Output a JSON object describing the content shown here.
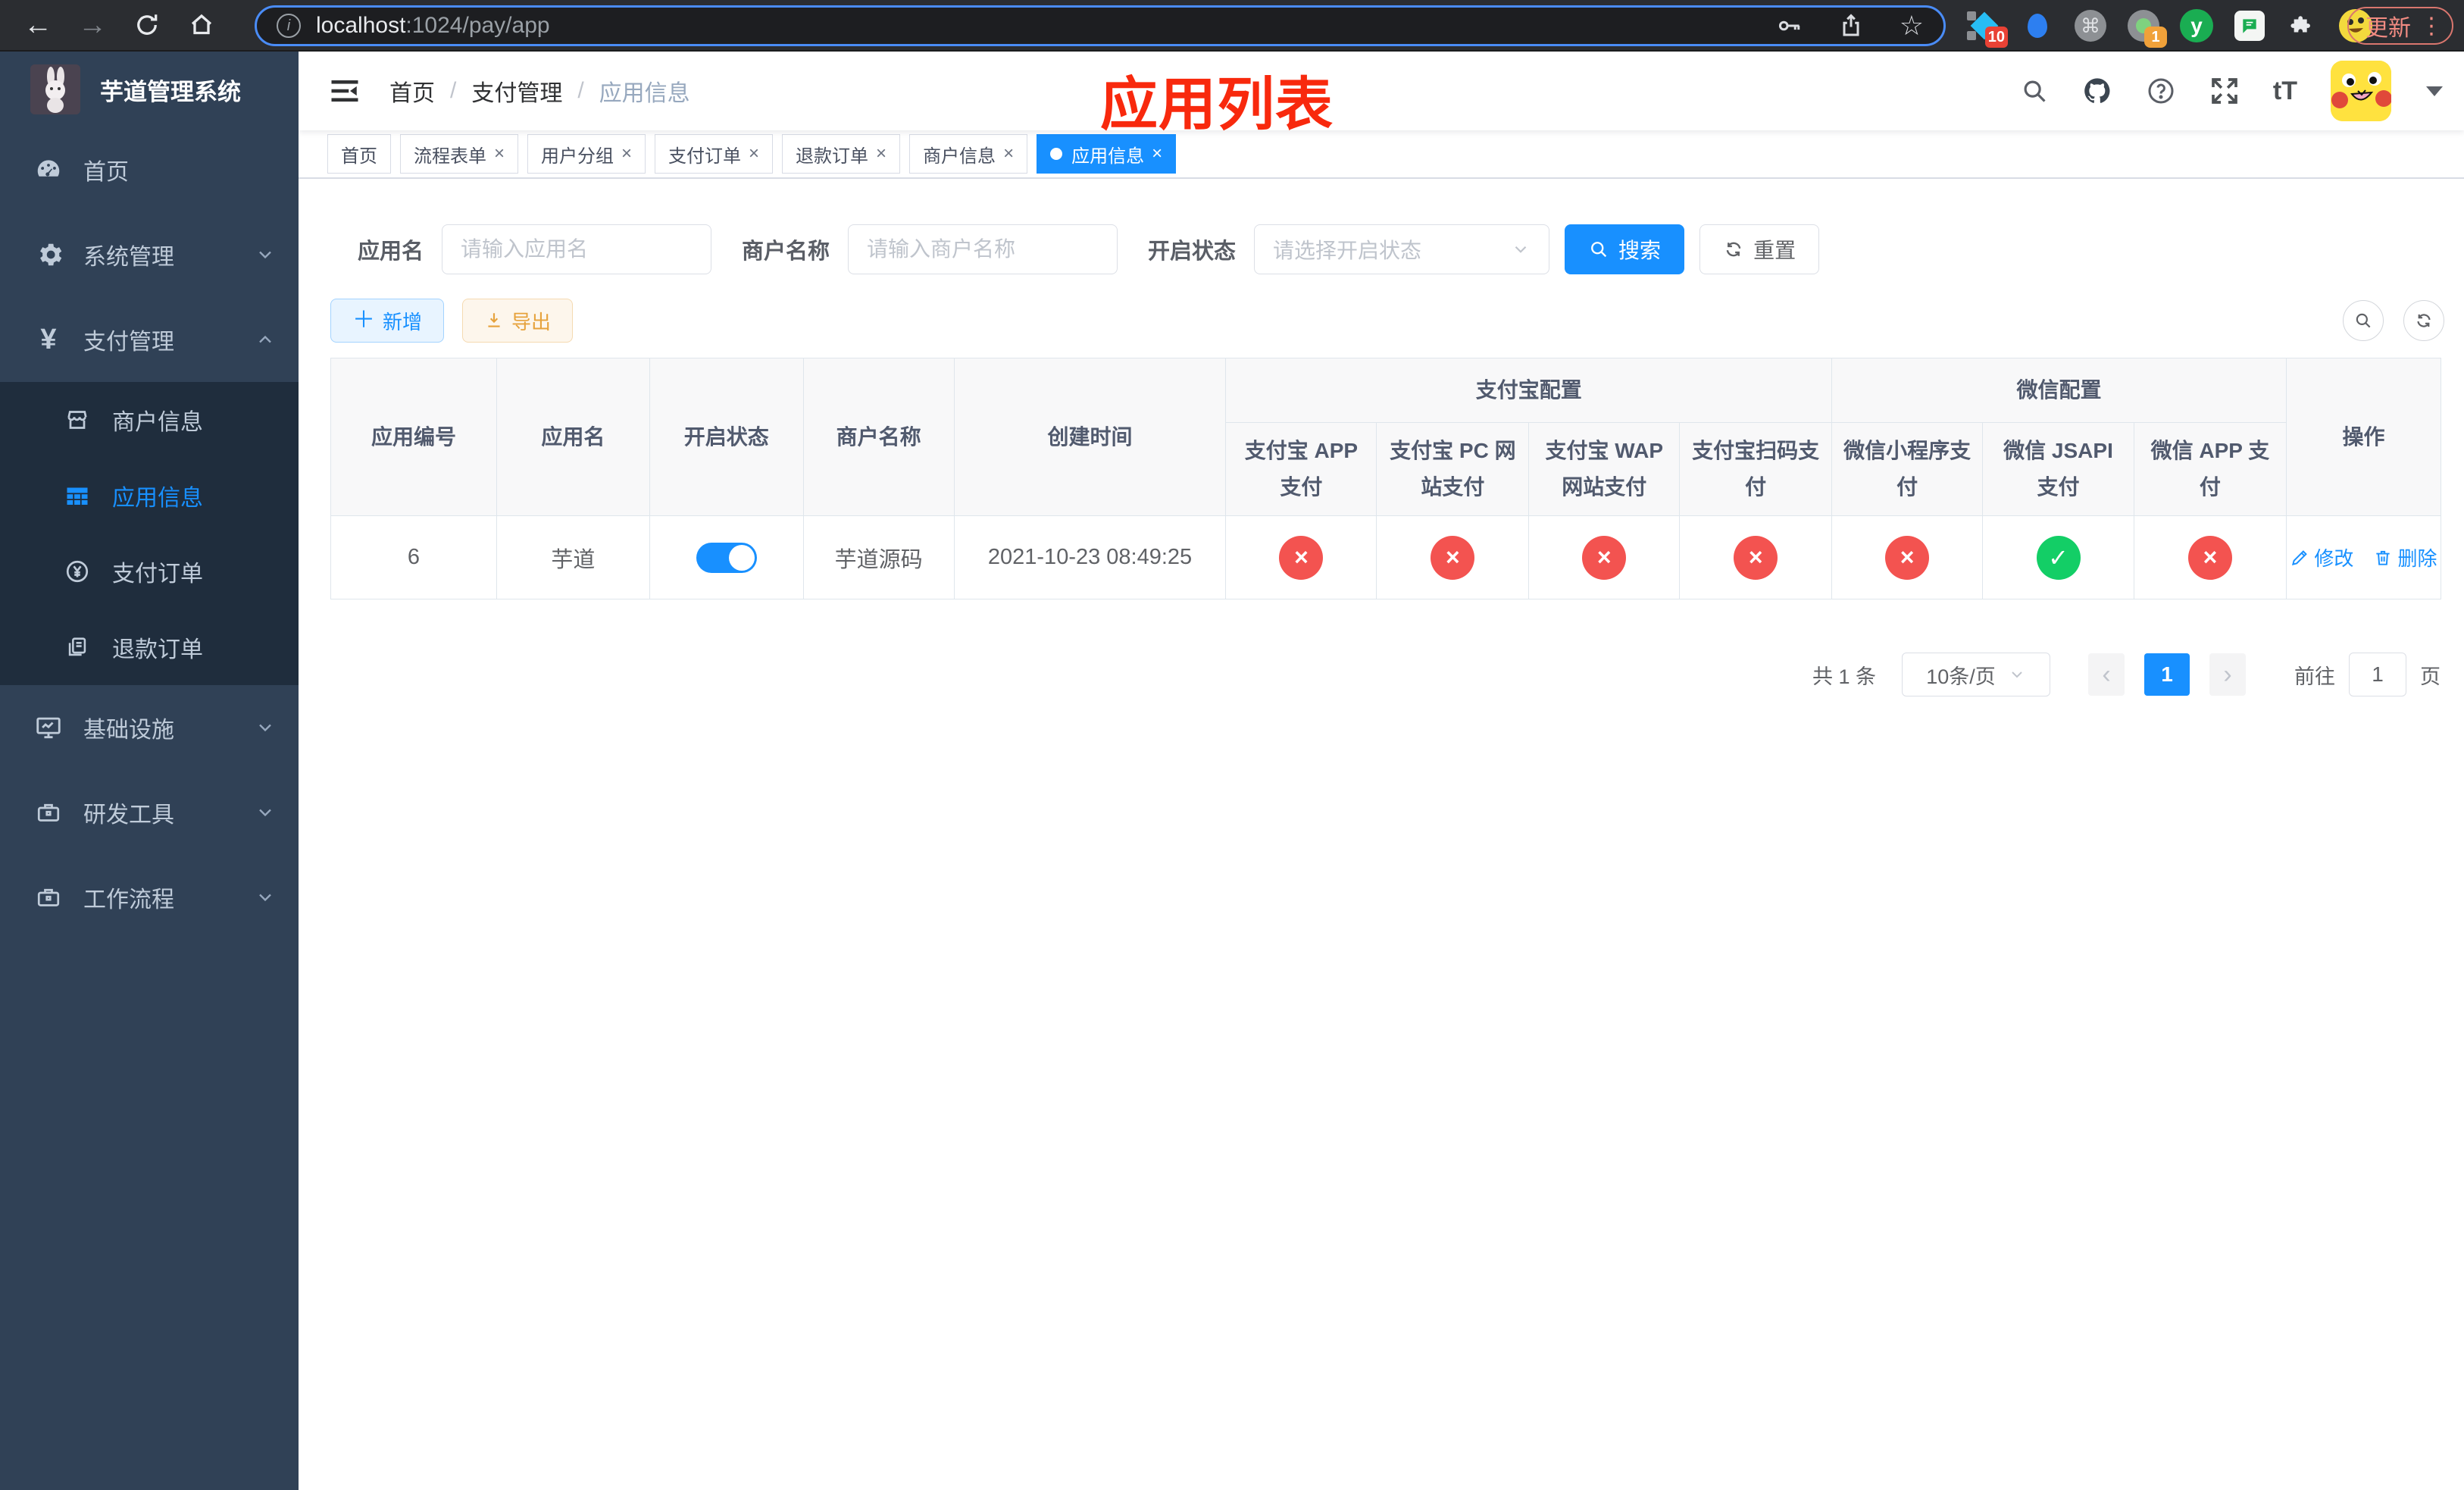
{
  "colors": {
    "accent": "#1890ff",
    "danger": "#f35350",
    "success": "#13ce66",
    "warning": "#e6a23c",
    "annotation": "#f8290d",
    "sidebar_bg": "#304156",
    "submenu_bg": "#1f2d3d"
  },
  "browser": {
    "url_host": "localhost",
    "url_path": ":1024/pay/app",
    "update_button": "更新",
    "ext_badge_pin": "10",
    "ext_badge_tab": "1",
    "ext_command_glyph": "⌘",
    "ext_y_glyph": "y"
  },
  "sidebar": {
    "logo_title": "芋道管理系统",
    "items": [
      {
        "label": "首页"
      },
      {
        "label": "系统管理"
      },
      {
        "label": "支付管理"
      },
      {
        "label": "商户信息"
      },
      {
        "label": "应用信息"
      },
      {
        "label": "支付订单"
      },
      {
        "label": "退款订单"
      },
      {
        "label": "基础设施"
      },
      {
        "label": "研发工具"
      },
      {
        "label": "工作流程"
      }
    ]
  },
  "breadcrumb": {
    "items": [
      "首页",
      "支付管理",
      "应用信息"
    ],
    "separator": "/"
  },
  "annotation": {
    "title": "应用列表"
  },
  "header_icons": {
    "font_size_glyph": "tT"
  },
  "tabs": [
    {
      "label": "首页"
    },
    {
      "label": "流程表单"
    },
    {
      "label": "用户分组"
    },
    {
      "label": "支付订单"
    },
    {
      "label": "退款订单"
    },
    {
      "label": "商户信息"
    },
    {
      "label": "应用信息"
    }
  ],
  "filters": {
    "app_name_label": "应用名",
    "app_name_placeholder": "请输入应用名",
    "merchant_label": "商户名称",
    "merchant_placeholder": "请输入商户名称",
    "status_label": "开启状态",
    "status_placeholder": "请选择开启状态",
    "search_button": "搜索",
    "reset_button": "重置"
  },
  "toolbar": {
    "add_button": "新增",
    "export_button": "导出"
  },
  "table": {
    "groups": {
      "alipay": "支付宝配置",
      "wechat": "微信配置"
    },
    "columns": {
      "app_id": "应用编号",
      "app_name": "应用名",
      "status": "开启状态",
      "merchant": "商户名称",
      "created": "创建时间",
      "alipay_app": "支付宝 APP 支付",
      "alipay_pc": "支付宝 PC 网站支付",
      "alipay_wap": "支付宝 WAP 网站支付",
      "alipay_qr": "支付宝扫码支付",
      "wx_lite": "微信小程序支付",
      "wx_jsapi": "微信 JSAPI 支付",
      "wx_app": "微信 APP 支付",
      "actions": "操作"
    },
    "row": {
      "app_id": "6",
      "app_name": "芋道",
      "enabled": true,
      "merchant": "芋道源码",
      "created": "2021-10-23 08:49:25",
      "pay_status": [
        false,
        false,
        false,
        false,
        false,
        true,
        false
      ],
      "edit_label": "修改",
      "delete_label": "删除"
    }
  },
  "status_glyphs": {
    "ok": "✓",
    "no": "×"
  },
  "pagination": {
    "total_text": "共 1 条",
    "page_size": "10条/页",
    "current_page": "1",
    "goto_label": "前往",
    "goto_value": "1",
    "goto_suffix": "页"
  }
}
